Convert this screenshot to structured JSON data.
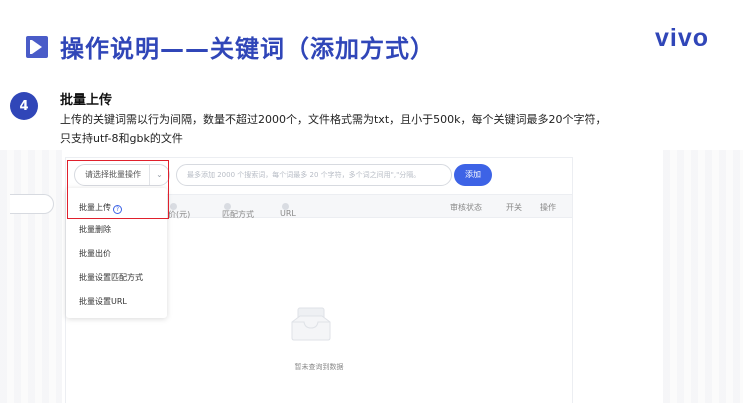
{
  "slide": {
    "title": "操作说明——关键词（添加方式）",
    "logo": "vivo",
    "accent_color": "#3046b8",
    "title_icon": "play-bar-icon"
  },
  "step": {
    "number": "4",
    "title": "批量上传",
    "desc_line1": "上传的关键词需以行为间隔，数量不超过2000个，文件格式需为txt，且小于500k，每个关键词最多20个字符，",
    "desc_line2": "只支持utf-8和gbk的文件"
  },
  "app": {
    "batch_select": "请选择批量操作",
    "chevron_icon": "chevron-down-icon",
    "keyword_placeholder": "最多添加 2000 个搜索词，每个词最多 20 个字符，多个词之间用\",\"分隔。",
    "add_button": "添加",
    "add_button_color": "#3d63e6",
    "columns": {
      "bid": "价(元)",
      "match": "匹配方式",
      "url": "URL",
      "review": "审核状态",
      "switch": "开关",
      "action": "操作"
    },
    "empty_icon": "empty-tray-icon",
    "empty_text": "暂未查询到数据"
  },
  "dropdown": {
    "items": [
      {
        "label": "批量上传",
        "help_icon": "help-circle-icon"
      },
      {
        "label": "批量删除"
      },
      {
        "label": "批量出价"
      },
      {
        "label": "批量设置匹配方式"
      },
      {
        "label": "批量设置URL"
      }
    ],
    "highlight_color": "#e0202c"
  }
}
